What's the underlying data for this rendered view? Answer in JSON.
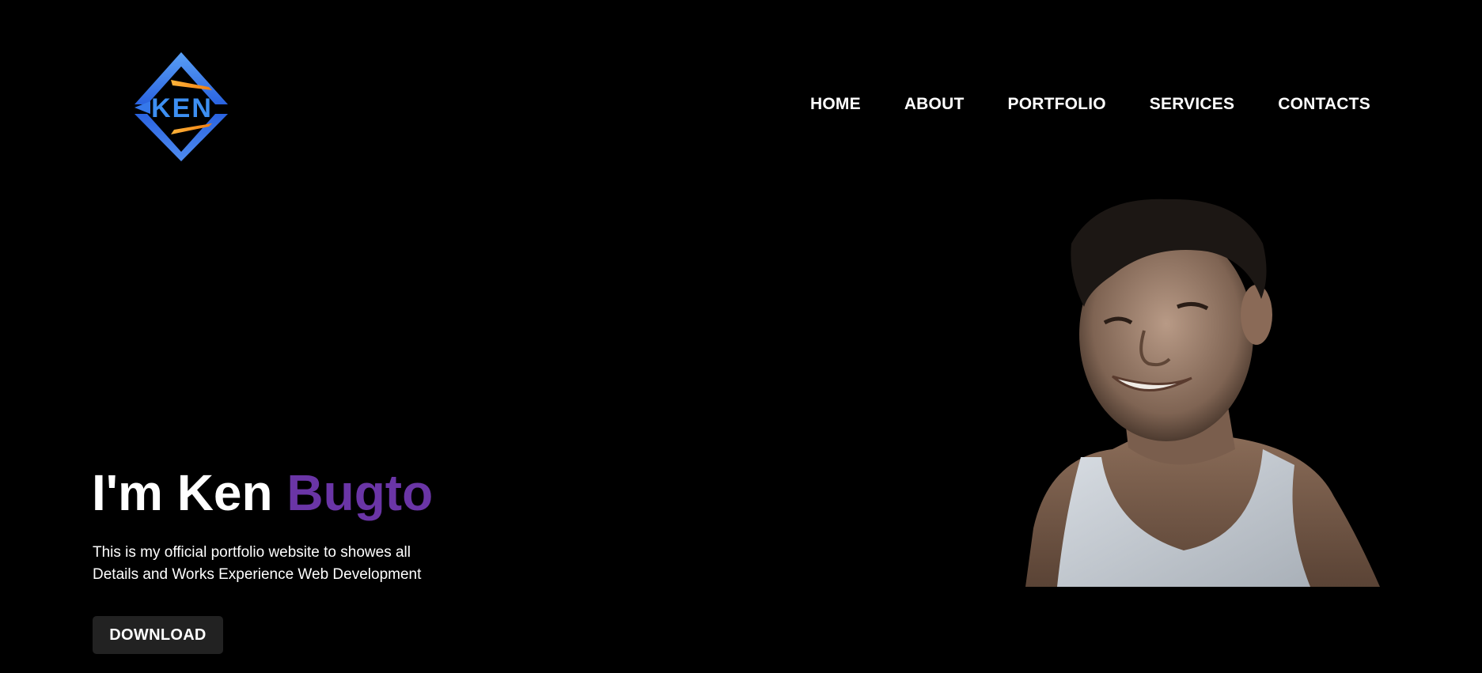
{
  "logo": {
    "text": "KEN",
    "colors": {
      "diamond_top": "#4f8cf0",
      "diamond_bottom": "#2f6fe6",
      "accent": "#f39a1c",
      "text": "#3d8ff2"
    }
  },
  "nav": {
    "items": [
      {
        "label": "HOME"
      },
      {
        "label": "ABOUT"
      },
      {
        "label": "PORTFOLIO"
      },
      {
        "label": "SERVICES"
      },
      {
        "label": "CONTACTS"
      }
    ]
  },
  "hero": {
    "title_prefix": "I'm Ken",
    "title_accent": "Bugto",
    "accent_color": "#6a35a6",
    "description_line1": "This is my official portfolio website to showes all",
    "description_line2": "Details and Works Experience Web Development",
    "download_label": "DOWNLOAD"
  }
}
